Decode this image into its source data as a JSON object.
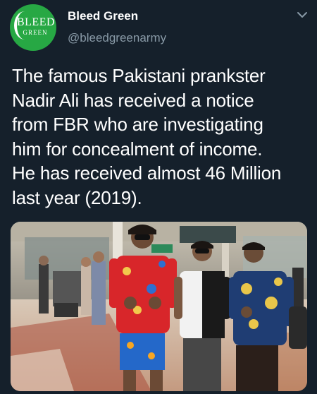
{
  "tweet": {
    "avatar": {
      "logo_main": "BLEED",
      "logo_sub": "GREEN",
      "color": "#27a844"
    },
    "display_name": "Bleed Green",
    "handle": "@bleedgreenarmy",
    "text_lines": [
      "The famous Pakistani prankster",
      "Nadir Ali has received a notice",
      "from FBR who are investigating",
      "him for concealment of income.",
      "He has received almost 46 Million",
      "last year (2019)."
    ],
    "menu_icon": "chevron-down-icon",
    "photo": {
      "subject": "three men posing in an airport terminal"
    }
  }
}
